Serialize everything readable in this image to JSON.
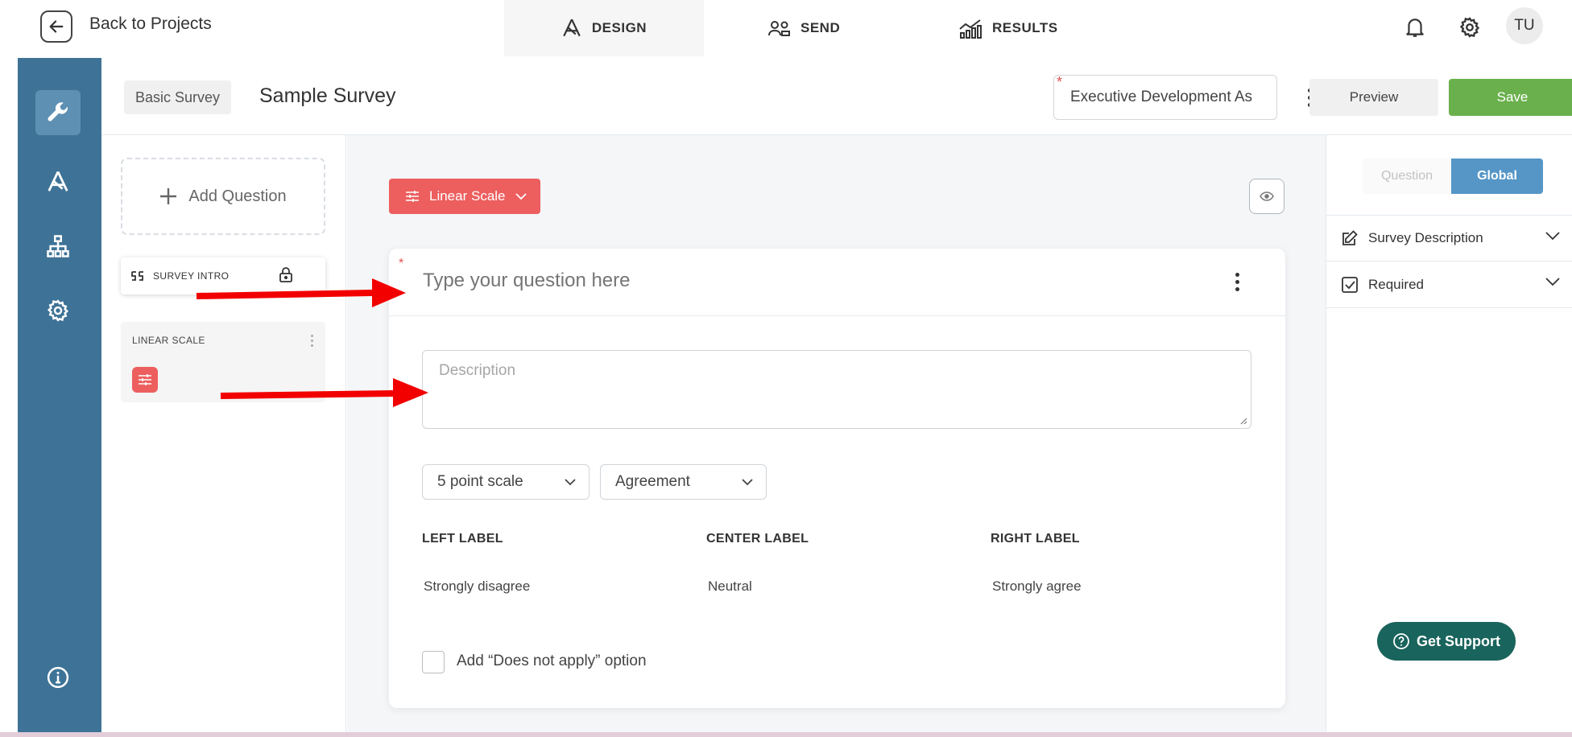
{
  "topbar": {
    "back_label": "Back to Projects",
    "tabs": [
      {
        "label": "DESIGN",
        "icon": "design-icon",
        "active": true
      },
      {
        "label": "SEND",
        "icon": "people-icon",
        "active": false
      },
      {
        "label": "RESULTS",
        "icon": "chart-icon",
        "active": false
      }
    ],
    "avatar_initials": "TU"
  },
  "header": {
    "chip": "Basic Survey",
    "title": "Sample Survey",
    "assessment_value": "Executive Development As",
    "preview_label": "Preview",
    "save_label": "Save"
  },
  "question_list": {
    "add_label": "Add Question",
    "intro_label": "SURVEY INTRO",
    "item_title": "LINEAR SCALE"
  },
  "canvas": {
    "type_label": "Linear Scale",
    "question_placeholder": "Type your question here",
    "description_placeholder": "Description",
    "scale_select": "5 point scale",
    "type_select": "Agreement",
    "columns": [
      {
        "head": "LEFT LABEL",
        "value": "Strongly disagree"
      },
      {
        "head": "CENTER LABEL",
        "value": "Neutral"
      },
      {
        "head": "RIGHT LABEL",
        "value": "Strongly agree"
      }
    ],
    "does_not_apply_label": "Add “Does not apply” option"
  },
  "right_panel": {
    "seg_question": "Question",
    "seg_global": "Global",
    "accordions": [
      {
        "label": "Survey Description",
        "icon": "edit-icon"
      },
      {
        "label": "Required",
        "icon": "checkbox-checked-icon"
      }
    ],
    "support_label": "Get Support"
  },
  "colors": {
    "sidebar": "#3e7397",
    "accent_red": "#ed5e5e",
    "save_green": "#6ab04c",
    "global_blue": "#5596c7",
    "support_teal": "#19645c"
  }
}
